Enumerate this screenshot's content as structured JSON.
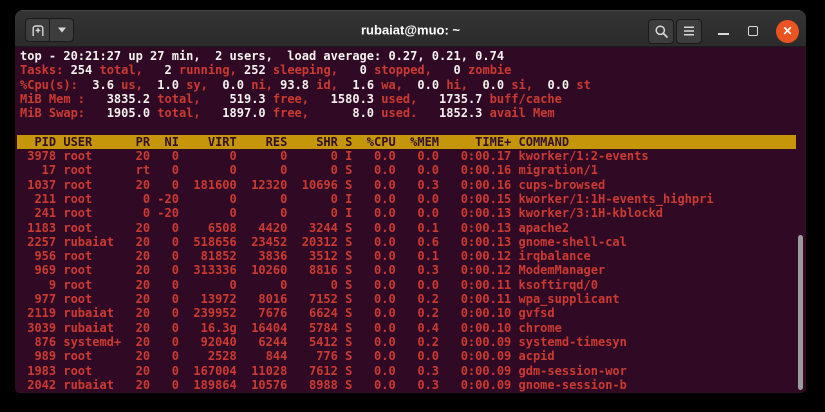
{
  "titlebar": {
    "title": "rubaiat@muo: ~",
    "icons": {
      "new_tab": "new-tab",
      "tab_dropdown": "▾",
      "search": "magnifier",
      "menu": "hamburger",
      "minimize": "–",
      "maximize": "□",
      "close": "✕"
    }
  },
  "terminal": {
    "colors": {
      "background": "#300A24",
      "text_red": "#CB3A32",
      "text_white": "#F4F1F0",
      "header_bg": "#C5960A",
      "header_fg": "#33102A",
      "close_button": "#E95420"
    },
    "summary_lines": [
      [
        {
          "t": "top - 20:21:27 up 27 min,  2 users,  load average: 0.27, 0.21, 0.74",
          "c": "wht"
        }
      ],
      [
        {
          "t": "Tasks: ",
          "c": "red"
        },
        {
          "t": "254",
          "c": "wht"
        },
        {
          "t": " total, ",
          "c": "red"
        },
        {
          "t": "  2",
          "c": "wht"
        },
        {
          "t": " running, ",
          "c": "red"
        },
        {
          "t": "252",
          "c": "wht"
        },
        {
          "t": " sleeping, ",
          "c": "red"
        },
        {
          "t": "  0",
          "c": "wht"
        },
        {
          "t": " stopped, ",
          "c": "red"
        },
        {
          "t": "  0",
          "c": "wht"
        },
        {
          "t": " zombie",
          "c": "red"
        }
      ],
      [
        {
          "t": "%Cpu(s): ",
          "c": "red"
        },
        {
          "t": " 3.6",
          "c": "wht"
        },
        {
          "t": " us, ",
          "c": "red"
        },
        {
          "t": " 1.0",
          "c": "wht"
        },
        {
          "t": " sy, ",
          "c": "red"
        },
        {
          "t": " 0.0",
          "c": "wht"
        },
        {
          "t": " ni, ",
          "c": "red"
        },
        {
          "t": "93.8",
          "c": "wht"
        },
        {
          "t": " id, ",
          "c": "red"
        },
        {
          "t": " 1.6",
          "c": "wht"
        },
        {
          "t": " wa, ",
          "c": "red"
        },
        {
          "t": " 0.0",
          "c": "wht"
        },
        {
          "t": " hi, ",
          "c": "red"
        },
        {
          "t": " 0.0",
          "c": "wht"
        },
        {
          "t": " si, ",
          "c": "red"
        },
        {
          "t": " 0.0",
          "c": "wht"
        },
        {
          "t": " st",
          "c": "red"
        }
      ],
      [
        {
          "t": "MiB Mem : ",
          "c": "red"
        },
        {
          "t": "  3835.2",
          "c": "wht"
        },
        {
          "t": " total, ",
          "c": "red"
        },
        {
          "t": "   519.3",
          "c": "wht"
        },
        {
          "t": " free, ",
          "c": "red"
        },
        {
          "t": "  1580.3",
          "c": "wht"
        },
        {
          "t": " used, ",
          "c": "red"
        },
        {
          "t": "  1735.7",
          "c": "wht"
        },
        {
          "t": " buff/cache",
          "c": "red"
        }
      ],
      [
        {
          "t": "MiB Swap: ",
          "c": "red"
        },
        {
          "t": "  1905.0",
          "c": "wht"
        },
        {
          "t": " total, ",
          "c": "red"
        },
        {
          "t": "  1897.0",
          "c": "wht"
        },
        {
          "t": " free, ",
          "c": "red"
        },
        {
          "t": "     8.0",
          "c": "wht"
        },
        {
          "t": " used. ",
          "c": "red"
        },
        {
          "t": "  1852.3",
          "c": "wht"
        },
        {
          "t": " avail Mem",
          "c": "red"
        }
      ]
    ],
    "header_row": "  PID USER      PR  NI    VIRT    RES    SHR S  %CPU  %MEM     TIME+ COMMAND",
    "process_rows": [
      " 3978 root      20   0       0      0      0 I   0.0   0.0   0:00.17 kworker/1:2-events",
      "   17 root      rt   0       0      0      0 S   0.0   0.0   0:00.16 migration/1",
      " 1037 root      20   0  181600  12320  10696 S   0.0   0.3   0:00.16 cups-browsed",
      "  211 root       0 -20       0      0      0 I   0.0   0.0   0:00.15 kworker/1:1H-events_highpri",
      "  241 root       0 -20       0      0      0 I   0.0   0.0   0:00.13 kworker/3:1H-kblockd",
      " 1183 root      20   0    6508   4420   3244 S   0.0   0.1   0:00.13 apache2",
      " 2257 rubaiat   20   0  518656  23452  20312 S   0.0   0.6   0:00.13 gnome-shell-cal",
      "  956 root      20   0   81852   3836   3512 S   0.0   0.1   0:00.12 irqbalance",
      "  969 root      20   0  313336  10260   8816 S   0.0   0.3   0:00.12 ModemManager",
      "    9 root      20   0       0      0      0 S   0.0   0.0   0:00.11 ksoftirqd/0",
      "  977 root      20   0   13972   8016   7152 S   0.0   0.2   0:00.11 wpa_supplicant",
      " 2119 rubaiat   20   0  239952   7676   6624 S   0.0   0.2   0:00.10 gvfsd",
      " 3039 rubaiat   20   0   16.3g  16404   5784 S   0.0   0.4   0:00.10 chrome",
      "  876 systemd+  20   0   92040   6244   5412 S   0.0   0.2   0:00.09 systemd-timesyn",
      "  989 root      20   0    2528    844    776 S   0.0   0.0   0:00.09 acpid",
      " 1983 root      20   0  167004  11028   7612 S   0.0   0.3   0:00.09 gdm-session-wor",
      " 2042 rubaiat   20   0  189864  10576   8988 S   0.0   0.3   0:00.09 gnome-session-b"
    ]
  }
}
